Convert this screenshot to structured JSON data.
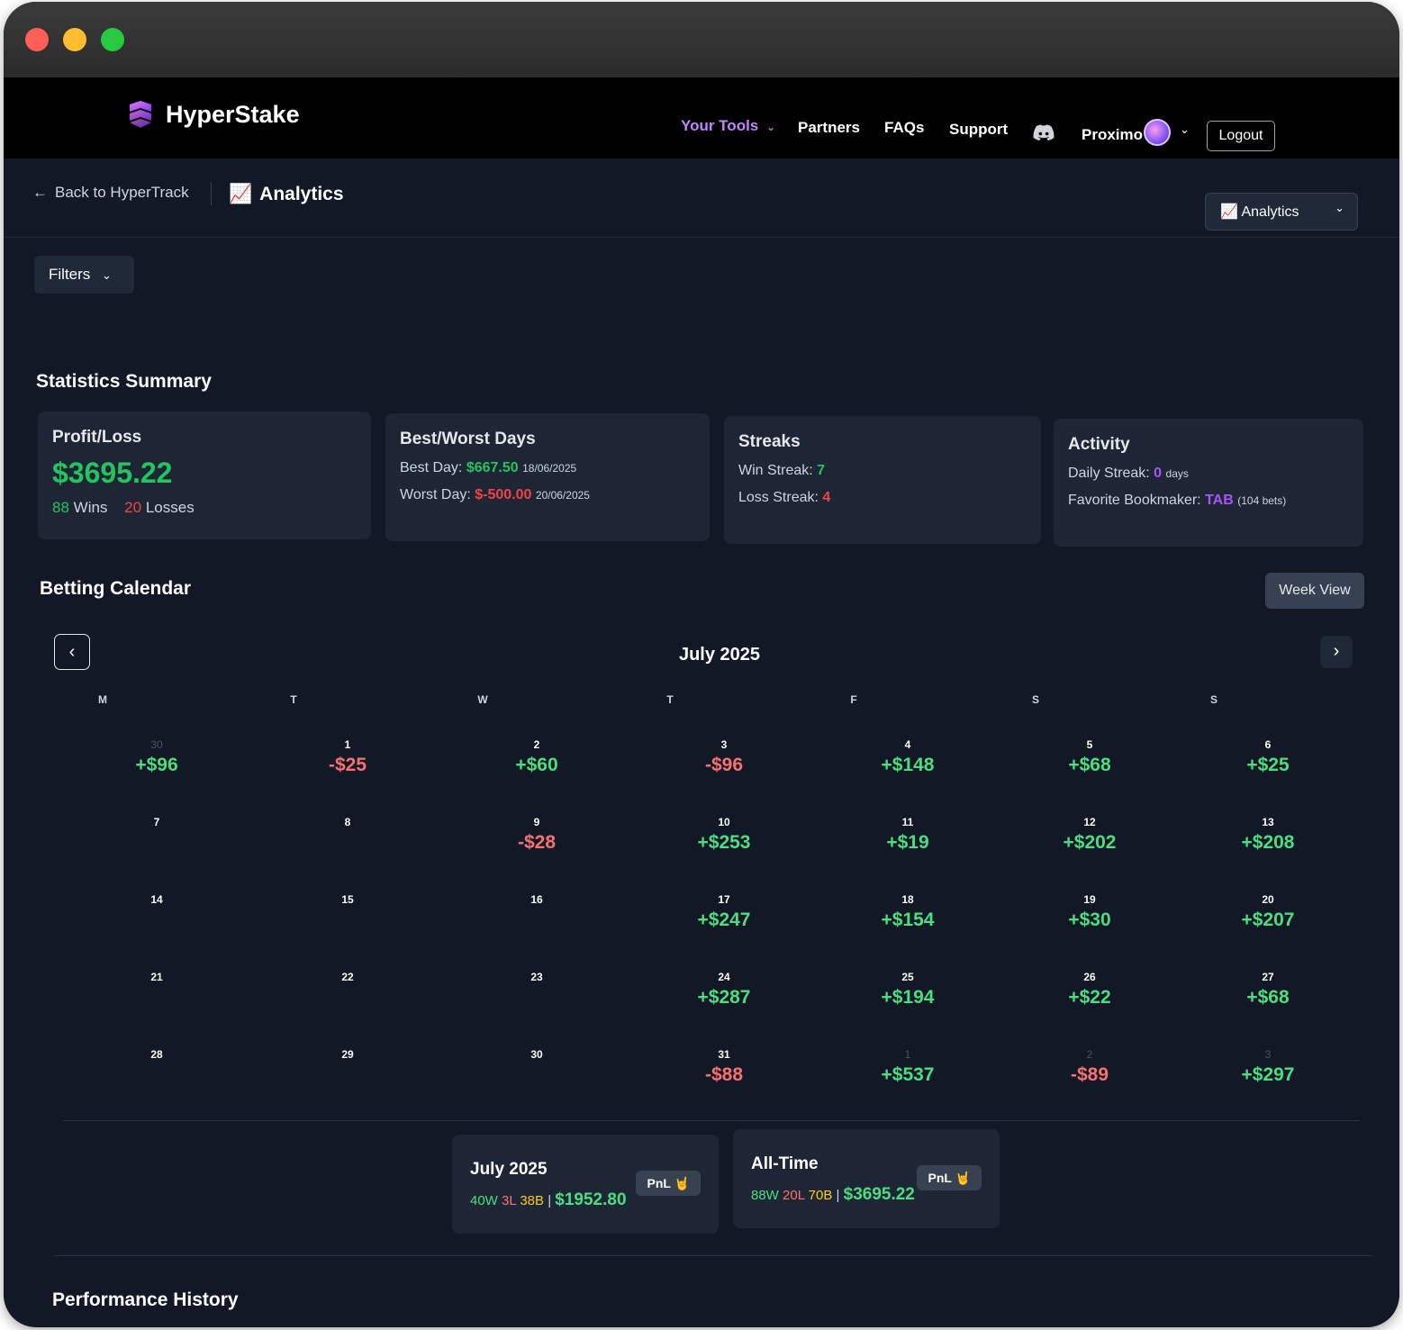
{
  "window": {
    "traffic_lights": {
      "close": "#ff5f57",
      "minimize": "#febc2e",
      "zoom": "#28c840"
    }
  },
  "nav": {
    "brand": "HyperStake",
    "links": {
      "your_tools": "Your Tools",
      "partners": "Partners",
      "faqs": "FAQs",
      "support": "Support"
    },
    "user": "Proximo",
    "logout": "Logout",
    "accent": "#c084fc"
  },
  "subbar": {
    "back": "Back to HyperTrack",
    "title": "Analytics",
    "select_value": "Analytics"
  },
  "filters": {
    "label": "Filters"
  },
  "stats": {
    "heading": "Statistics Summary",
    "profit": {
      "title": "Profit/Loss",
      "amount": "$3695.22",
      "wins": "88",
      "wins_label": "Wins",
      "losses": "20",
      "losses_label": "Losses"
    },
    "bestworst": {
      "title": "Best/Worst Days",
      "best_label": "Best Day:",
      "best_value": "$667.50",
      "best_date": "18/06/2025",
      "worst_label": "Worst Day:",
      "worst_value": "$-500.00",
      "worst_date": "20/06/2025"
    },
    "streaks": {
      "title": "Streaks",
      "win_label": "Win Streak:",
      "win_value": "7",
      "loss_label": "Loss Streak:",
      "loss_value": "4"
    },
    "activity": {
      "title": "Activity",
      "daily_label": "Daily Streak:",
      "daily_value": "0",
      "daily_unit": "days",
      "fav_label": "Favorite Bookmaker:",
      "fav_value": "TAB",
      "fav_note": "(104 bets)"
    }
  },
  "calendar": {
    "heading": "Betting Calendar",
    "view_button": "Week View",
    "month": "July 2025",
    "weekdays": [
      "M",
      "T",
      "W",
      "T",
      "F",
      "S",
      "S"
    ],
    "weeks": [
      [
        {
          "d": "30",
          "a": "+$96",
          "m": true
        },
        {
          "d": "1",
          "a": "-$25"
        },
        {
          "d": "2",
          "a": "+$60"
        },
        {
          "d": "3",
          "a": "-$96"
        },
        {
          "d": "4",
          "a": "+$148"
        },
        {
          "d": "5",
          "a": "+$68"
        },
        {
          "d": "6",
          "a": "+$25"
        }
      ],
      [
        {
          "d": "7",
          "a": ""
        },
        {
          "d": "8",
          "a": ""
        },
        {
          "d": "9",
          "a": "-$28"
        },
        {
          "d": "10",
          "a": "+$253"
        },
        {
          "d": "11",
          "a": "+$19"
        },
        {
          "d": "12",
          "a": "+$202"
        },
        {
          "d": "13",
          "a": "+$208"
        }
      ],
      [
        {
          "d": "14",
          "a": ""
        },
        {
          "d": "15",
          "a": ""
        },
        {
          "d": "16",
          "a": ""
        },
        {
          "d": "17",
          "a": "+$247"
        },
        {
          "d": "18",
          "a": "+$154"
        },
        {
          "d": "19",
          "a": "+$30"
        },
        {
          "d": "20",
          "a": "+$207"
        }
      ],
      [
        {
          "d": "21",
          "a": ""
        },
        {
          "d": "22",
          "a": ""
        },
        {
          "d": "23",
          "a": ""
        },
        {
          "d": "24",
          "a": "+$287"
        },
        {
          "d": "25",
          "a": "+$194"
        },
        {
          "d": "26",
          "a": "+$22"
        },
        {
          "d": "27",
          "a": "+$68"
        }
      ],
      [
        {
          "d": "28",
          "a": ""
        },
        {
          "d": "29",
          "a": ""
        },
        {
          "d": "30",
          "a": ""
        },
        {
          "d": "31",
          "a": "-$88"
        },
        {
          "d": "1",
          "a": "+$537",
          "m": true
        },
        {
          "d": "2",
          "a": "-$89",
          "m": true
        },
        {
          "d": "3",
          "a": "+$297",
          "m": true
        }
      ]
    ],
    "positive_color": "#4ade80",
    "negative_color": "#f87171"
  },
  "summaries": {
    "month": {
      "title": "July 2025",
      "w": "40W",
      "l": "3L",
      "b": "38B",
      "sep": "|",
      "total": "$1952.80",
      "pnl": "PnL 🤘"
    },
    "alltime": {
      "title": "All-Time",
      "w": "88W",
      "l": "20L",
      "b": "70B",
      "sep": "|",
      "total": "$3695.22",
      "pnl": "PnL 🤘"
    }
  },
  "performance": {
    "heading": "Performance History"
  }
}
